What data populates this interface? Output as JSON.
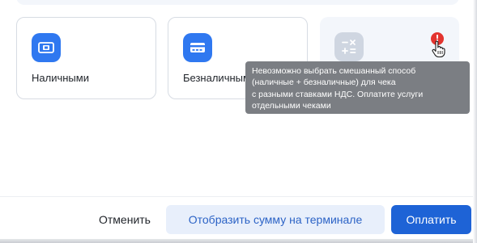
{
  "payment_methods": [
    {
      "label": "Наличными",
      "icon": "cash-icon"
    },
    {
      "label": "Безналичными",
      "icon": "card-icon"
    },
    {
      "label": "",
      "icon": "calculator-icon",
      "disabled": true
    }
  ],
  "warning_badge": "!",
  "tooltip": {
    "lines": [
      "Невозможно выбрать смешанный способ",
      "(наличные + безналичные) для чека",
      "с разными ставками НДС. Оплатите услуги",
      "отдельными чеками"
    ]
  },
  "footer": {
    "cancel_label": "Отменить",
    "terminal_label": "Отобразить сумму на терминале",
    "pay_label": "Оплатить"
  },
  "colors": {
    "accent": "#1e63d6",
    "icon_blue": "#2f78f0",
    "tooltip_bg": "#7b7e83",
    "warning": "#e3342f"
  }
}
